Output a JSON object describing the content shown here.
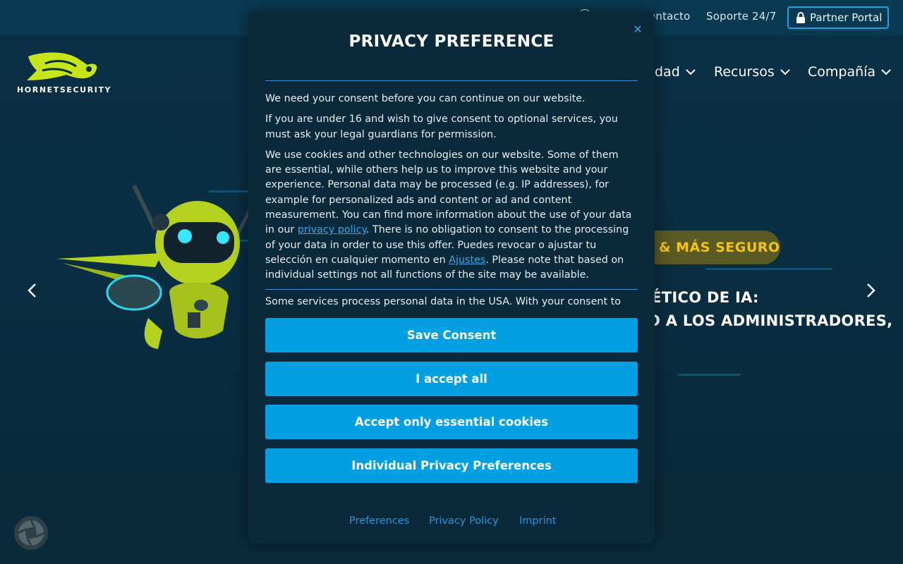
{
  "topbar": {
    "contact": "ontacto",
    "support": "Soporte 24/7",
    "partner_portal": "Partner Portal"
  },
  "brand": {
    "name": "HORNETSECURITY"
  },
  "nav": {
    "item1": "dad",
    "item2": "Recursos",
    "item3": "Compañía"
  },
  "hero": {
    "badge": "& MÁS SEGURO",
    "headline_1": "IÉTICO DE IA:",
    "headline_2": "O A LOS ADMINISTRADORES,"
  },
  "modal": {
    "title": "PRIVACY PREFERENCE",
    "p1": "We need your consent before you can continue on our website.",
    "p2": "If you are under 16 and wish to give consent to optional services, you must ask your legal guardians for permission.",
    "p3_a": "We use cookies and other technologies on our website. Some of them are essential, while others help us to improve this website and your experience. Personal data may be processed (e.g. IP addresses), for example for personalized ads and content or ad and content measurement. You can find more information about the use of your data in our ",
    "p3_link": "privacy policy",
    "p3_b": ". There is no obligation to consent to the processing of your data in order to use this offer. Puedes revocar o ajustar tu selección en cualquier momento en ",
    "p3_link2": "Ajustes",
    "p3_c": ". Please note that based on individual settings not all functions of the site may be available.",
    "p4": "Some services process personal data in the USA. With your consent to use",
    "buttons": {
      "save": "Save Consent",
      "accept_all": "I accept all",
      "essential": "Accept only essential cookies",
      "individual": "Individual Privacy Preferences"
    },
    "footer": {
      "preferences": "Preferences",
      "privacy": "Privacy Policy",
      "imprint": "Imprint"
    }
  },
  "colors": {
    "primary_button": "#029fe3",
    "link": "#38a4e6",
    "badge_text": "#f2c413",
    "background": "#082c3d"
  }
}
